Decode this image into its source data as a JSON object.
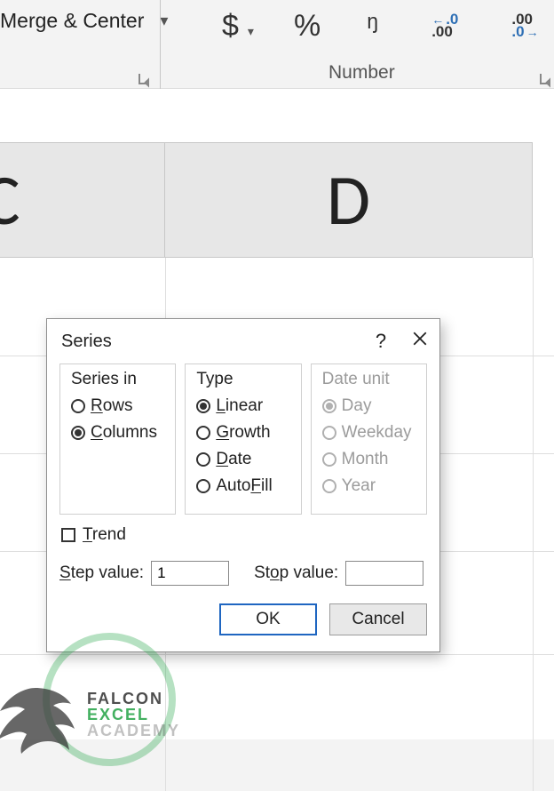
{
  "ribbon": {
    "merge_center": "Merge & Center",
    "group_number_label": "Number"
  },
  "columns": {
    "C": "C",
    "D": "D"
  },
  "dialog": {
    "title": "Series",
    "help": "?",
    "close": "×",
    "series_in": {
      "legend": "Series in",
      "rows": "Rows",
      "columns": "Columns",
      "selected": "columns"
    },
    "type": {
      "legend": "Type",
      "linear": "Linear",
      "growth": "Growth",
      "date": "Date",
      "autofill": "AutoFill",
      "selected": "linear"
    },
    "date_unit": {
      "legend": "Date unit",
      "day": "Day",
      "weekday": "Weekday",
      "month": "Month",
      "year": "Year",
      "selected": "day",
      "enabled": false
    },
    "trend": {
      "label": "Trend",
      "checked": false
    },
    "step_label": "Step value:",
    "step_value": "1",
    "stop_label": "Stop value:",
    "stop_value": "",
    "ok": "OK",
    "cancel": "Cancel"
  },
  "watermark": {
    "l1": "FALCON",
    "l2": "EXCEL",
    "l3": "ACADEMY"
  }
}
